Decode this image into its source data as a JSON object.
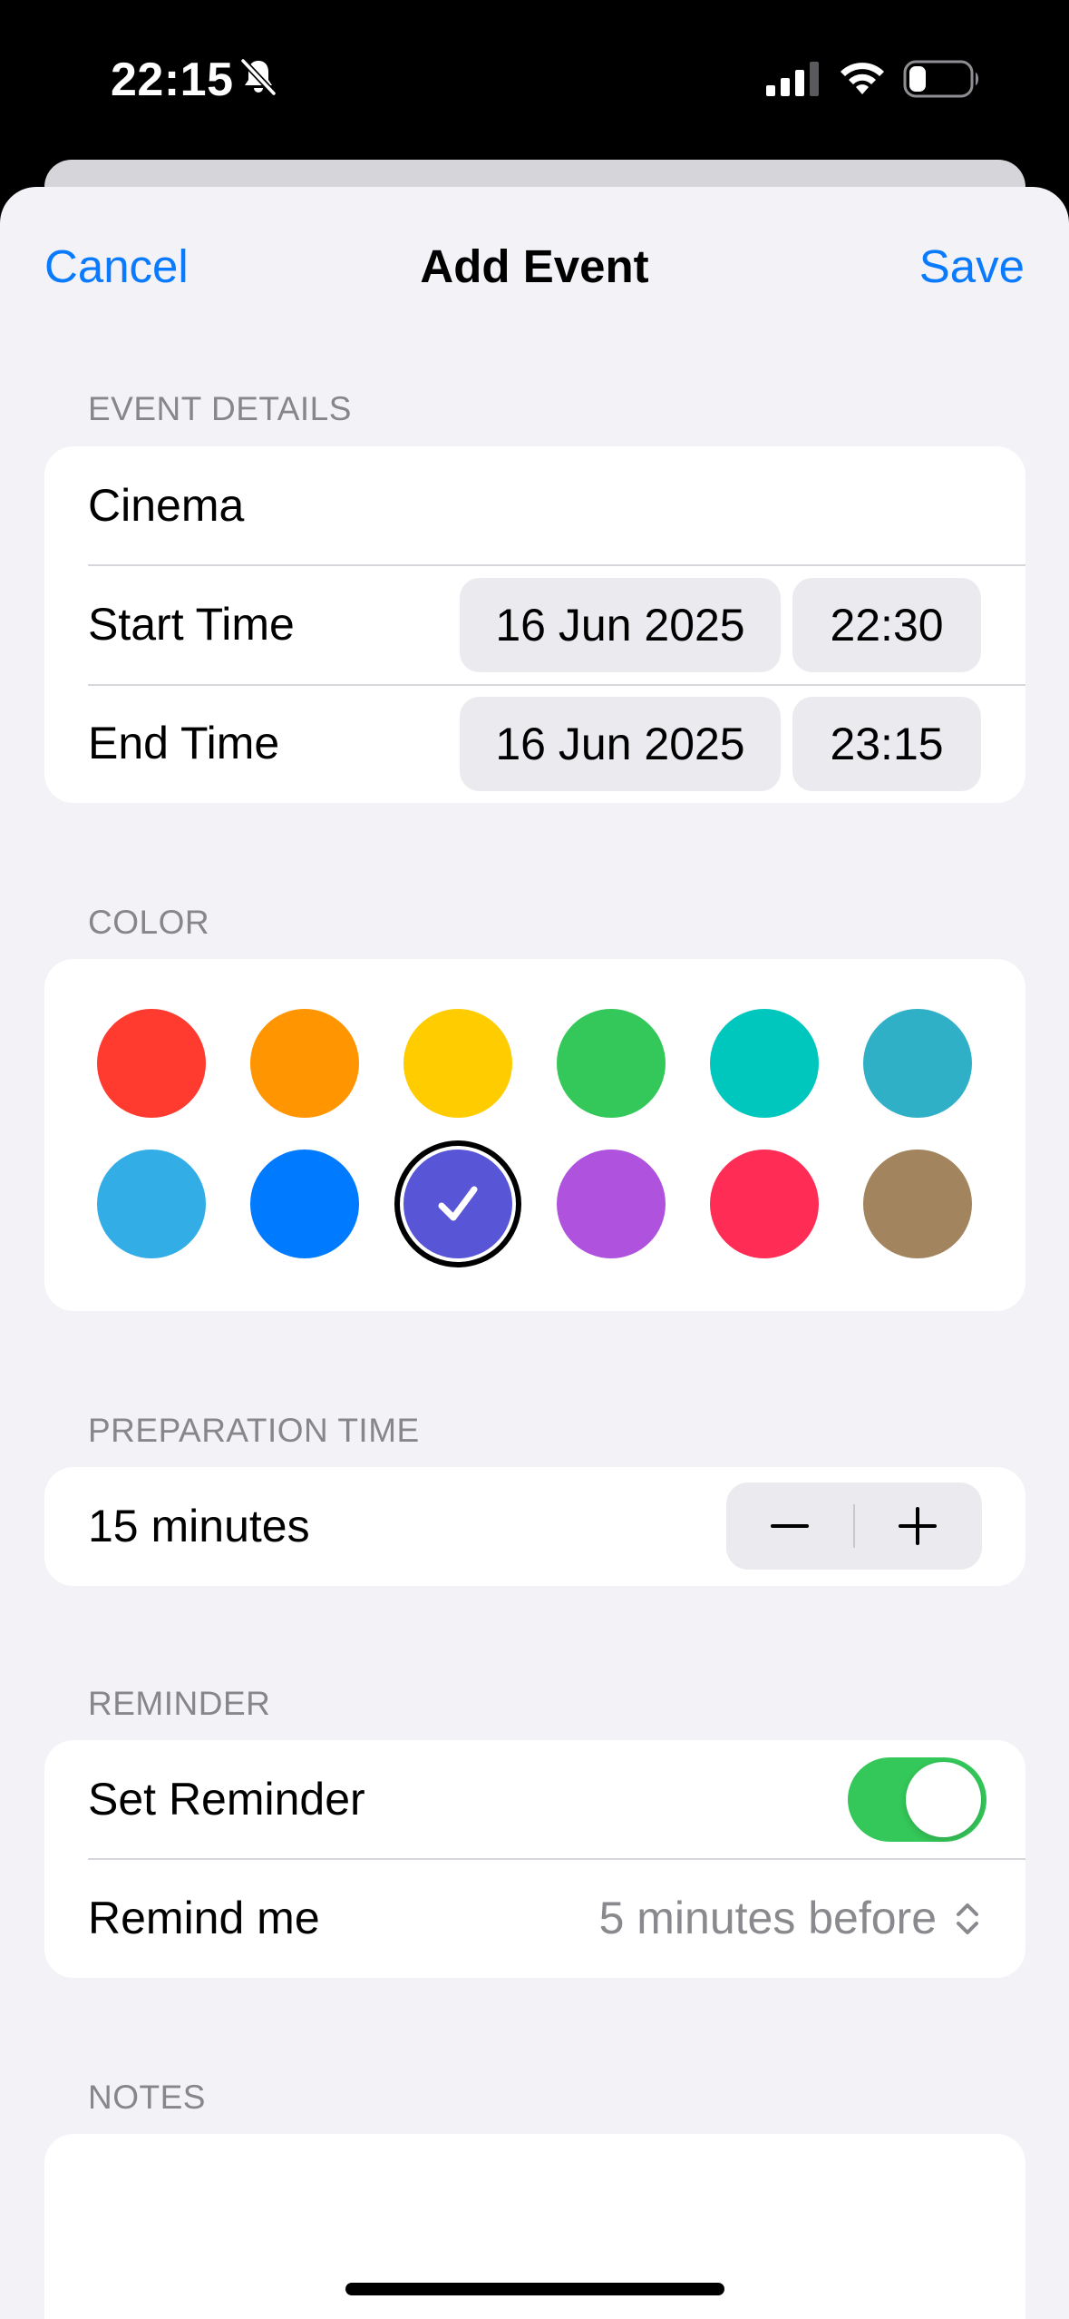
{
  "status_bar": {
    "time": "22:15",
    "icons": [
      "bell-slash-icon",
      "cellular-signal-icon",
      "wifi-icon",
      "battery-icon"
    ]
  },
  "nav": {
    "cancel_label": "Cancel",
    "title": "Add Event",
    "save_label": "Save"
  },
  "event_details": {
    "header": "EVENT DETAILS",
    "title_value": "Cinema",
    "start_label": "Start Time",
    "start_date": "16 Jun 2025",
    "start_time": "22:30",
    "end_label": "End Time",
    "end_date": "16 Jun 2025",
    "end_time": "23:15"
  },
  "color": {
    "header": "COLOR",
    "options": [
      "#ff3b30",
      "#ff9500",
      "#ffcc00",
      "#34c759",
      "#00c7be",
      "#30b0c7",
      "#32ade6",
      "#007aff",
      "#5856d6",
      "#af52de",
      "#ff2d55",
      "#a2845e"
    ],
    "selected_index": 8
  },
  "preparation_time": {
    "header": "PREPARATION TIME",
    "value": "15 minutes"
  },
  "reminder": {
    "header": "REMINDER",
    "set_label": "Set Reminder",
    "enabled": true,
    "remind_label": "Remind me",
    "remind_value": "5 minutes before"
  },
  "notes": {
    "header": "NOTES",
    "value": ""
  },
  "colors": {
    "accent": "#0a7aff",
    "toggle_on": "#34c759",
    "background": "#f2f2f7"
  }
}
